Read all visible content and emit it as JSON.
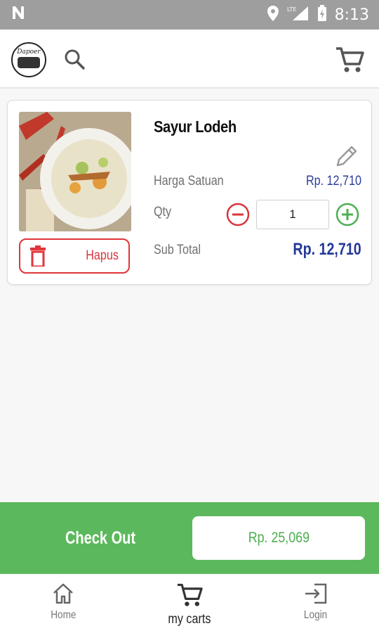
{
  "status_bar": {
    "time": "8:13",
    "network": "LTE"
  },
  "app_bar": {
    "logo_text": "Dapoer"
  },
  "cart_item": {
    "name": "Sayur Lodeh",
    "harga_label": "Harga Satuan",
    "harga_value": "Rp. 12,710",
    "qty_label": "Qty",
    "qty_value": "1",
    "subtotal_label": "Sub Total",
    "subtotal_value": "Rp. 12,710",
    "delete_label": "Hapus"
  },
  "checkout": {
    "label": "Check Out",
    "total": "Rp. 25,069"
  },
  "bottom_nav": [
    {
      "label": "Home",
      "icon": "home-icon",
      "active": false
    },
    {
      "label": "my carts",
      "icon": "cart-icon",
      "active": true
    },
    {
      "label": "Login",
      "icon": "login-icon",
      "active": false
    }
  ],
  "colors": {
    "accent_green": "#5cb85c",
    "delete_red": "#e0353a",
    "price_blue": "#2b3d9a",
    "status_bar": "#9e9e9e"
  }
}
